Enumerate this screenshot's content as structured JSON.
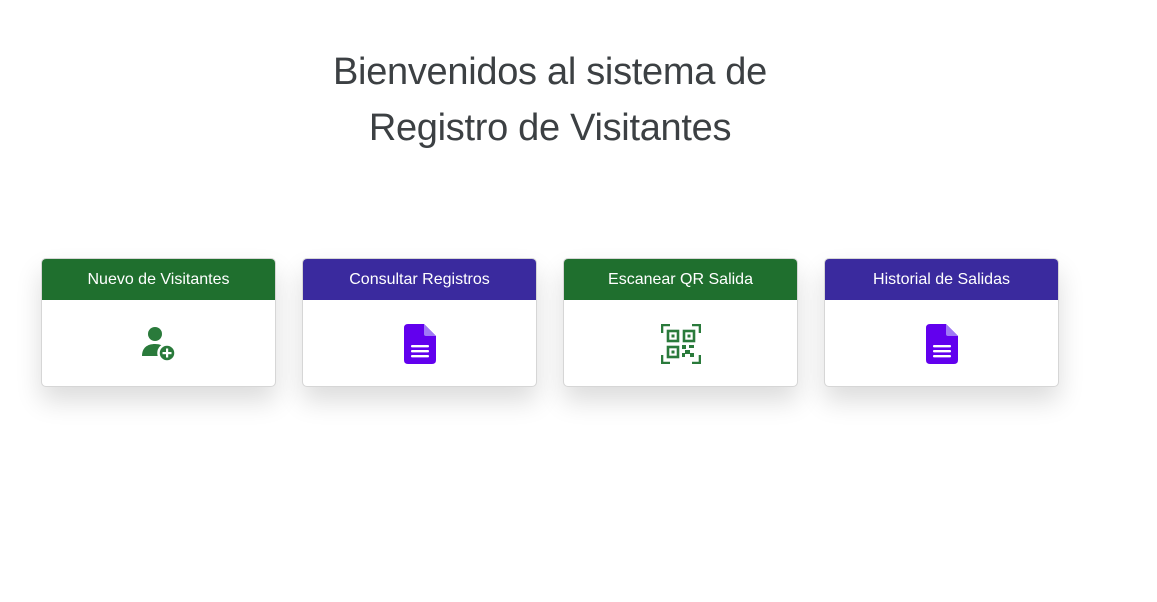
{
  "page": {
    "title_line1": "Bienvenidos al sistema de",
    "title_line2": "Registro de Visitantes"
  },
  "cards": [
    {
      "label": "Nuevo de Visitantes",
      "icon": "user-plus-icon",
      "header_color": "#1f6f2e",
      "icon_color": "#2a7a3b"
    },
    {
      "label": "Consultar Registros",
      "icon": "document-icon",
      "header_color": "#3a2a9e",
      "icon_color": "#6200ee"
    },
    {
      "label": "Escanear QR Salida",
      "icon": "qr-scan-icon",
      "header_color": "#1f6f2e",
      "icon_color": "#2a7a3b"
    },
    {
      "label": "Historial de Salidas",
      "icon": "document-icon",
      "header_color": "#3a2a9e",
      "icon_color": "#6200ee"
    }
  ]
}
